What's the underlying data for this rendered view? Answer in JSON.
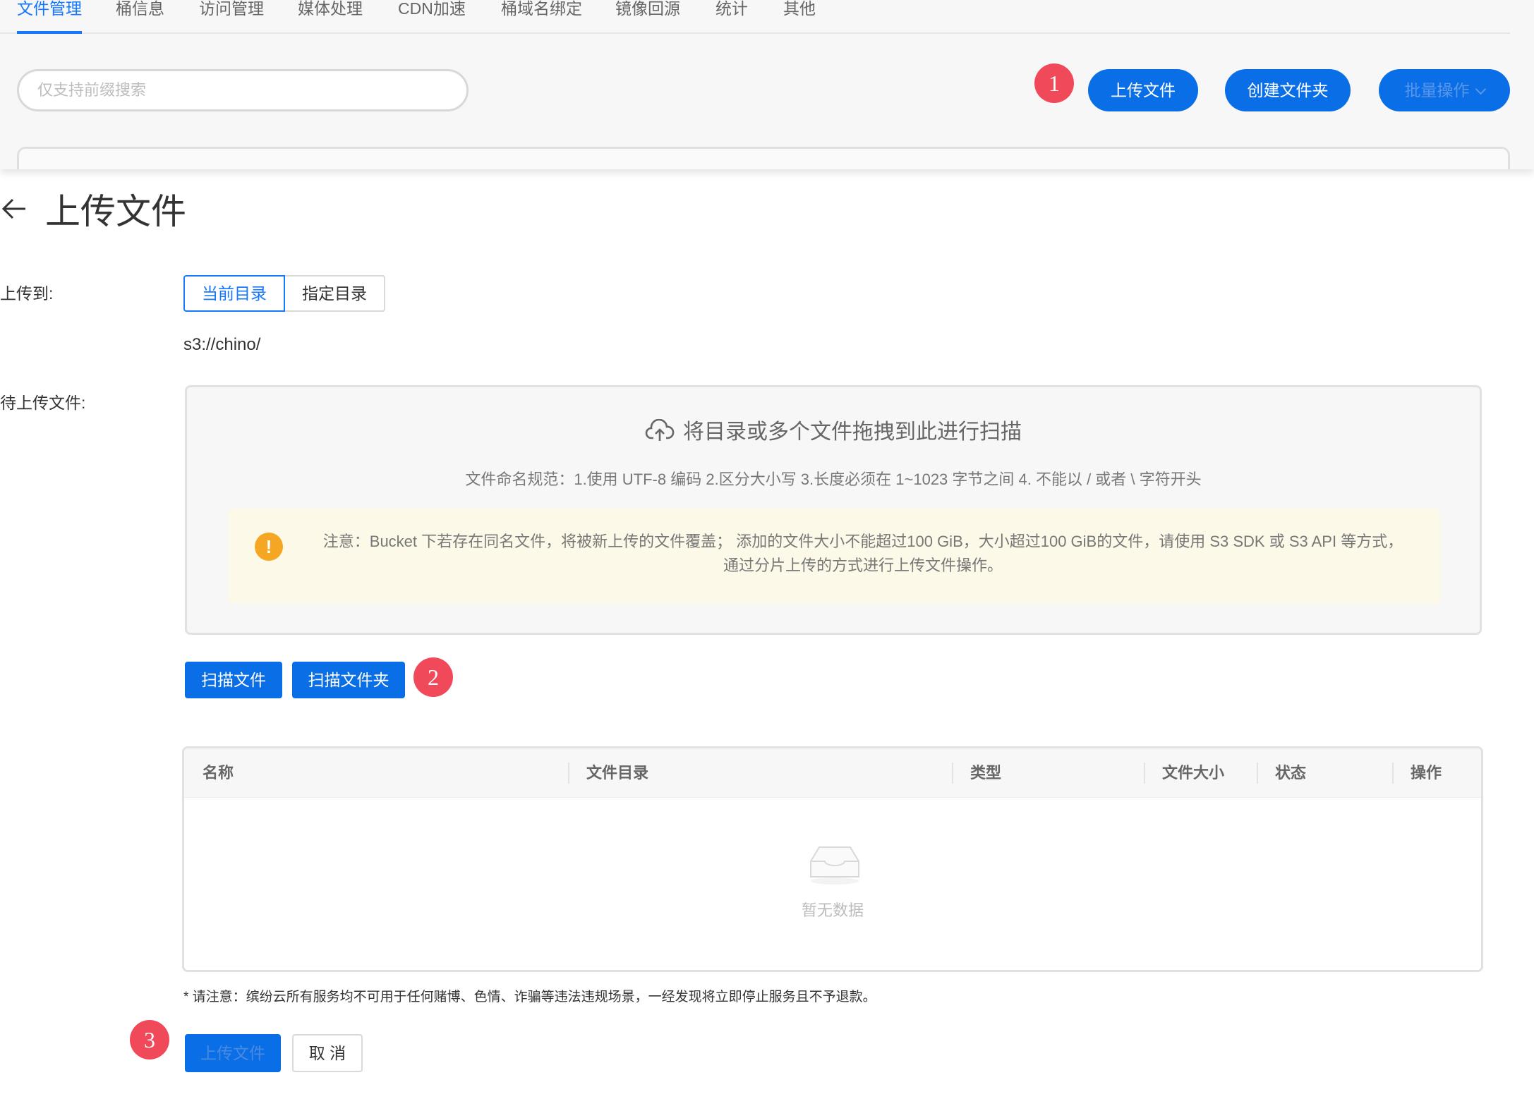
{
  "top_bar": {
    "tabs": [
      {
        "label": "文件管理",
        "active": true
      },
      {
        "label": "桶信息"
      },
      {
        "label": "访问管理"
      },
      {
        "label": "媒体处理"
      },
      {
        "label": "CDN加速"
      },
      {
        "label": "桶域名绑定"
      },
      {
        "label": "镜像回源"
      },
      {
        "label": "统计"
      },
      {
        "label": "其他"
      }
    ],
    "search_placeholder": "仅支持前缀搜索",
    "badge_1": "1",
    "upload_label": "上传文件",
    "create_folder_label": "创建文件夹",
    "batch_label": "批量操作"
  },
  "dialog": {
    "title": "上传文件",
    "upload_to_label": "上传到:",
    "target_options": [
      "当前目录",
      "指定目录"
    ],
    "current_path": "s3://chino/",
    "pending_label": "待上传文件:",
    "dropzone": {
      "title": "将目录或多个文件拖拽到此进行扫描",
      "rules": "文件命名规范：1.使用 UTF-8 编码 2.区分大小写 3.长度必须在 1~1023 字节之间 4. 不能以 / 或者 \\ 字符开头",
      "notice_line1": "注意：Bucket 下若存在同名文件，将被新上传的文件覆盖； 添加的文件大小不能超过100 GiB，大小超过100 GiB的文件，请使用 S3 SDK 或 S3 API 等方式，",
      "notice_line2": "通过分片上传的方式进行上传文件操作。",
      "warn_glyph": "!"
    },
    "scan_file_label": "扫描文件",
    "scan_folder_label": "扫描文件夹",
    "badge_2": "2",
    "table": {
      "columns": [
        "名称",
        "文件目录",
        "类型",
        "文件大小",
        "状态",
        "操作"
      ],
      "empty_text": "暂无数据"
    },
    "footnote": "* 请注意：缤纷云所有服务均不可用于任何赌博、色情、诈骗等违法违规场景，一经发现将立即停止服务且不予退款。",
    "badge_3": "3",
    "submit_label": "上传文件",
    "cancel_label": "取 消"
  },
  "colors": {
    "primary": "#0a6ee6",
    "tab_active": "#1677ff",
    "badge": "#f0495a",
    "warning": "#f5a623",
    "notice_bg": "#fdf9e8"
  }
}
